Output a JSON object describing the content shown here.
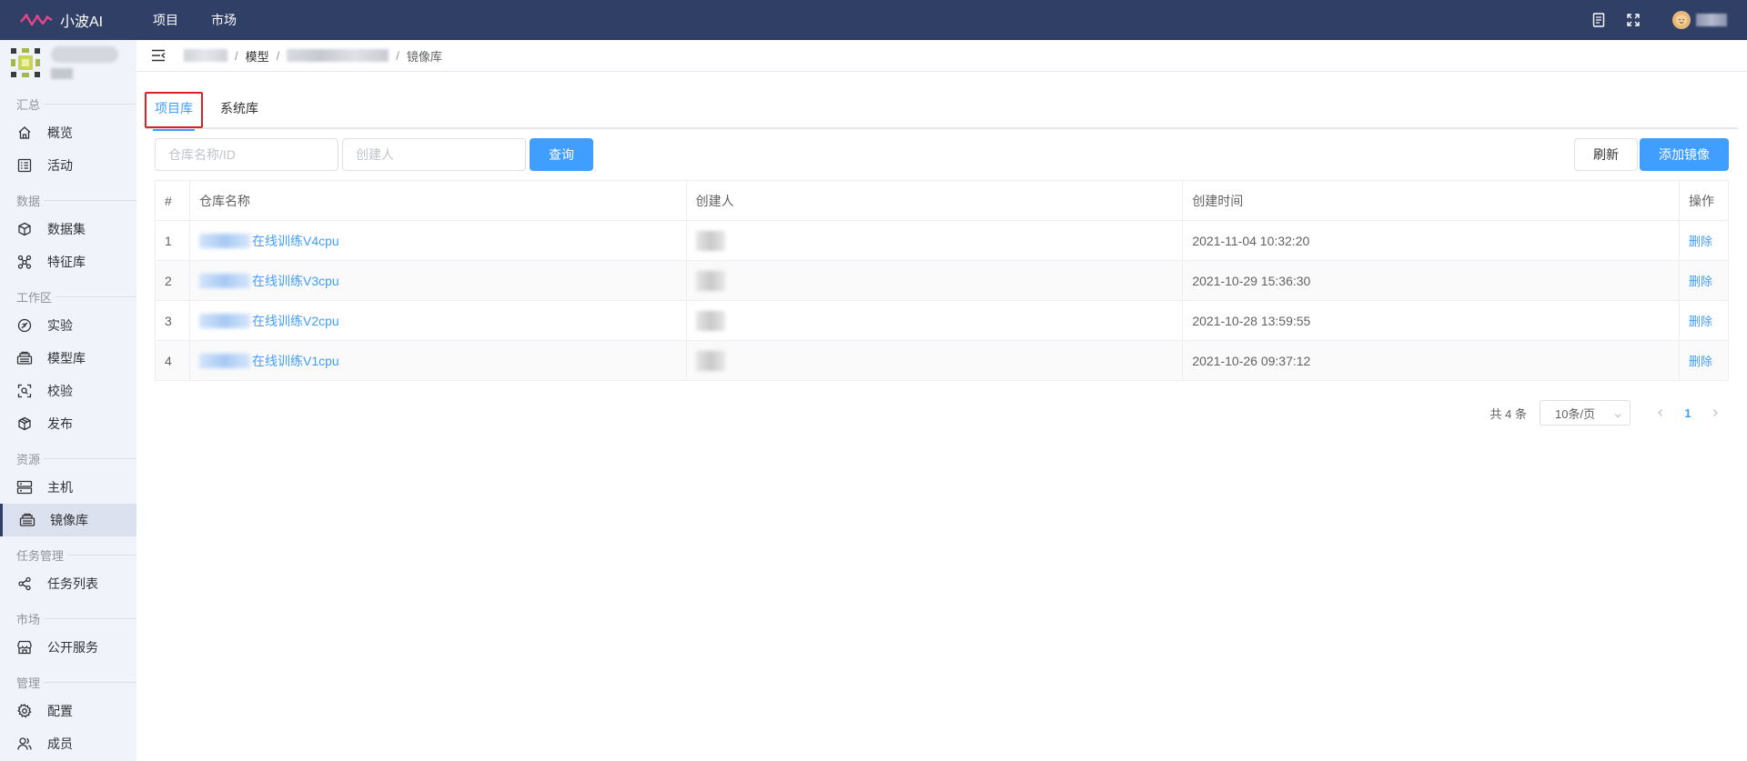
{
  "app": {
    "name": "小波AI",
    "accent": "#409eff",
    "topbar_bg": "#2f3f66"
  },
  "top_nav": [
    {
      "label": "项目"
    },
    {
      "label": "市场"
    }
  ],
  "top_right": {
    "icons": [
      "document-icon",
      "fullscreen-icon"
    ]
  },
  "sidebar": {
    "sections": [
      {
        "title": "汇总",
        "items": [
          {
            "label": "概览",
            "icon": "home-icon"
          },
          {
            "label": "活动",
            "icon": "activity-icon"
          }
        ]
      },
      {
        "title": "数据",
        "items": [
          {
            "label": "数据集",
            "icon": "cube-icon"
          },
          {
            "label": "特征库",
            "icon": "nodes-icon"
          }
        ]
      },
      {
        "title": "工作区",
        "items": [
          {
            "label": "实验",
            "icon": "experiment-icon"
          },
          {
            "label": "模型库",
            "icon": "model-icon"
          },
          {
            "label": "校验",
            "icon": "scan-icon"
          },
          {
            "label": "发布",
            "icon": "package-icon"
          }
        ]
      },
      {
        "title": "资源",
        "items": [
          {
            "label": "主机",
            "icon": "server-icon"
          },
          {
            "label": "镜像库",
            "icon": "image-repo-icon",
            "active": true
          }
        ]
      },
      {
        "title": "任务管理",
        "items": [
          {
            "label": "任务列表",
            "icon": "share-icon"
          }
        ]
      },
      {
        "title": "市场",
        "items": [
          {
            "label": "公开服务",
            "icon": "store-icon"
          }
        ]
      },
      {
        "title": "管理",
        "items": [
          {
            "label": "配置",
            "icon": "gear-icon"
          },
          {
            "label": "成员",
            "icon": "users-icon"
          }
        ]
      }
    ]
  },
  "breadcrumb": {
    "model": "模型",
    "current": "镜像库"
  },
  "tabs": [
    {
      "label": "项目库",
      "active": true
    },
    {
      "label": "系统库"
    }
  ],
  "toolbar": {
    "search_placeholder": "仓库名称/ID",
    "creator_placeholder": "创建人",
    "query_label": "查询",
    "refresh_label": "刷新",
    "add_label": "添加镜像"
  },
  "table": {
    "headers": {
      "idx": "#",
      "name": "仓库名称",
      "creator": "创建人",
      "time": "创建时间",
      "op": "操作"
    },
    "rows": [
      {
        "idx": "1",
        "name": "在线训练V4cpu",
        "time": "2021-11-04 10:32:20",
        "op": "删除"
      },
      {
        "idx": "2",
        "name": "在线训练V3cpu",
        "time": "2021-10-29 15:36:30",
        "op": "删除"
      },
      {
        "idx": "3",
        "name": "在线训练V2cpu",
        "time": "2021-10-28 13:59:55",
        "op": "删除"
      },
      {
        "idx": "4",
        "name": "在线训练V1cpu",
        "time": "2021-10-26 09:37:12",
        "op": "删除"
      }
    ]
  },
  "pagination": {
    "total": "共 4 条",
    "page_size": "10条/页",
    "current_page": "1"
  }
}
